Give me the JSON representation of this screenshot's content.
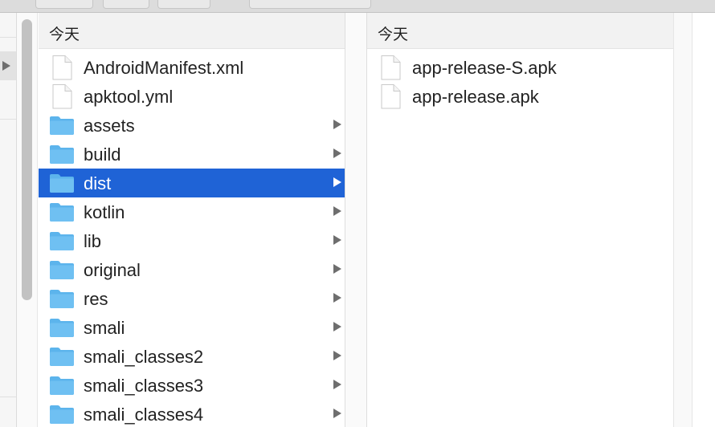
{
  "columns": {
    "middle": {
      "header": "今天",
      "items": [
        {
          "name": "AndroidManifest.xml",
          "kind": "file",
          "has_children": false,
          "selected": false
        },
        {
          "name": "apktool.yml",
          "kind": "file",
          "has_children": false,
          "selected": false
        },
        {
          "name": "assets",
          "kind": "folder",
          "has_children": true,
          "selected": false
        },
        {
          "name": "build",
          "kind": "folder",
          "has_children": true,
          "selected": false
        },
        {
          "name": "dist",
          "kind": "folder",
          "has_children": true,
          "selected": true
        },
        {
          "name": "kotlin",
          "kind": "folder",
          "has_children": true,
          "selected": false
        },
        {
          "name": "lib",
          "kind": "folder",
          "has_children": true,
          "selected": false
        },
        {
          "name": "original",
          "kind": "folder",
          "has_children": true,
          "selected": false
        },
        {
          "name": "res",
          "kind": "folder",
          "has_children": true,
          "selected": false
        },
        {
          "name": "smali",
          "kind": "folder",
          "has_children": true,
          "selected": false
        },
        {
          "name": "smali_classes2",
          "kind": "folder",
          "has_children": true,
          "selected": false
        },
        {
          "name": "smali_classes3",
          "kind": "folder",
          "has_children": true,
          "selected": false
        },
        {
          "name": "smali_classes4",
          "kind": "folder",
          "has_children": true,
          "selected": false
        }
      ]
    },
    "right": {
      "header": "今天",
      "items": [
        {
          "name": "app-release-S.apk",
          "kind": "file",
          "has_children": false,
          "selected": false
        },
        {
          "name": "app-release.apk",
          "kind": "file",
          "has_children": false,
          "selected": false
        }
      ]
    }
  },
  "icons": {
    "folder": "folder-icon",
    "file": "document-icon",
    "disclosure": "chevron-right-icon"
  },
  "colors": {
    "selection": "#1f63d6",
    "folder": "#6fc0f2",
    "header_bg": "#f2f2f2"
  }
}
